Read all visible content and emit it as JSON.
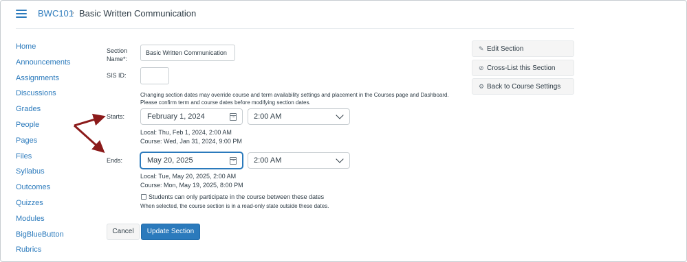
{
  "breadcrumb": {
    "course_code": "BWC101",
    "separator": "›",
    "current": "Basic Written Communication"
  },
  "nav": {
    "items": [
      {
        "label": "Home"
      },
      {
        "label": "Announcements"
      },
      {
        "label": "Assignments"
      },
      {
        "label": "Discussions"
      },
      {
        "label": "Grades"
      },
      {
        "label": "People"
      },
      {
        "label": "Pages"
      },
      {
        "label": "Files"
      },
      {
        "label": "Syllabus"
      },
      {
        "label": "Outcomes"
      },
      {
        "label": "Quizzes"
      },
      {
        "label": "Modules"
      },
      {
        "label": "BigBlueButton"
      },
      {
        "label": "Rubrics"
      }
    ]
  },
  "form": {
    "section_name_label": "Section Name*:",
    "section_name_value": "Basic Written Communication",
    "sis_id_label": "SIS ID:",
    "sis_id_value": "",
    "notice_line1": "Changing section dates may override course and term availability settings and placement in the Courses page and Dashboard.",
    "notice_line2": "Please confirm term and course dates before modifying section dates.",
    "starts": {
      "label": "Starts:",
      "date": "February 1, 2024",
      "time": "2:00 AM",
      "local": "Local: Thu, Feb 1, 2024, 2:00 AM",
      "course": "Course: Wed, Jan 31, 2024, 9:00 PM"
    },
    "ends": {
      "label": "Ends:",
      "date": "May 20, 2025",
      "time": "2:00 AM",
      "local": "Local: Tue, May 20, 2025, 2:00 AM",
      "course": "Course: Mon, May 19, 2025, 8:00 PM"
    },
    "restrict_checkbox_label": "Students can only participate in the course between these dates",
    "restrict_checkbox_checked": false,
    "restrict_help": "When selected, the course section is in a read-only state outside these dates.",
    "cancel_label": "Cancel",
    "update_label": "Update Section"
  },
  "sidebar": {
    "edit_section": "Edit Section",
    "cross_list": "Cross-List this Section",
    "back_to_settings": "Back to Course Settings"
  },
  "colors": {
    "link": "#2b7abc",
    "primary_button": "#2b7abc",
    "annotation_arrow": "#8b1a1a"
  }
}
